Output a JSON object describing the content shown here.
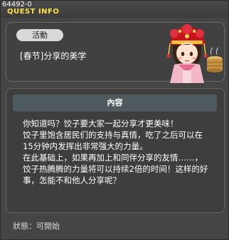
{
  "window": {
    "quest_id": "64492-0",
    "title": "QUEST INFO"
  },
  "quest": {
    "category_badge": "活動",
    "name": "[春节]分享的美学"
  },
  "content": {
    "header": "內容",
    "lines": [
      "你知道吗？饺子要大家一起分享才更美味！",
      "饺子里饱含居民们的支持与真情，吃了之后可以在",
      "15分钟内发挥出非常强大的力量。",
      "在此基础上，如果再加上和同伴分享的友情……，",
      "饺子热腾腾的力量将可以持续2倍的时间！这样的好",
      "事，怎能不和他人分享呢？"
    ]
  },
  "status": {
    "text": "狀態：可開始"
  },
  "icons": {
    "npc": "npc-portrait-icon",
    "dumpling": "dumpling-basket-icon"
  },
  "colors": {
    "title_yellow": "#ffe14a",
    "panel_bg": "#414141",
    "header_bg": "#4f5a5e"
  }
}
